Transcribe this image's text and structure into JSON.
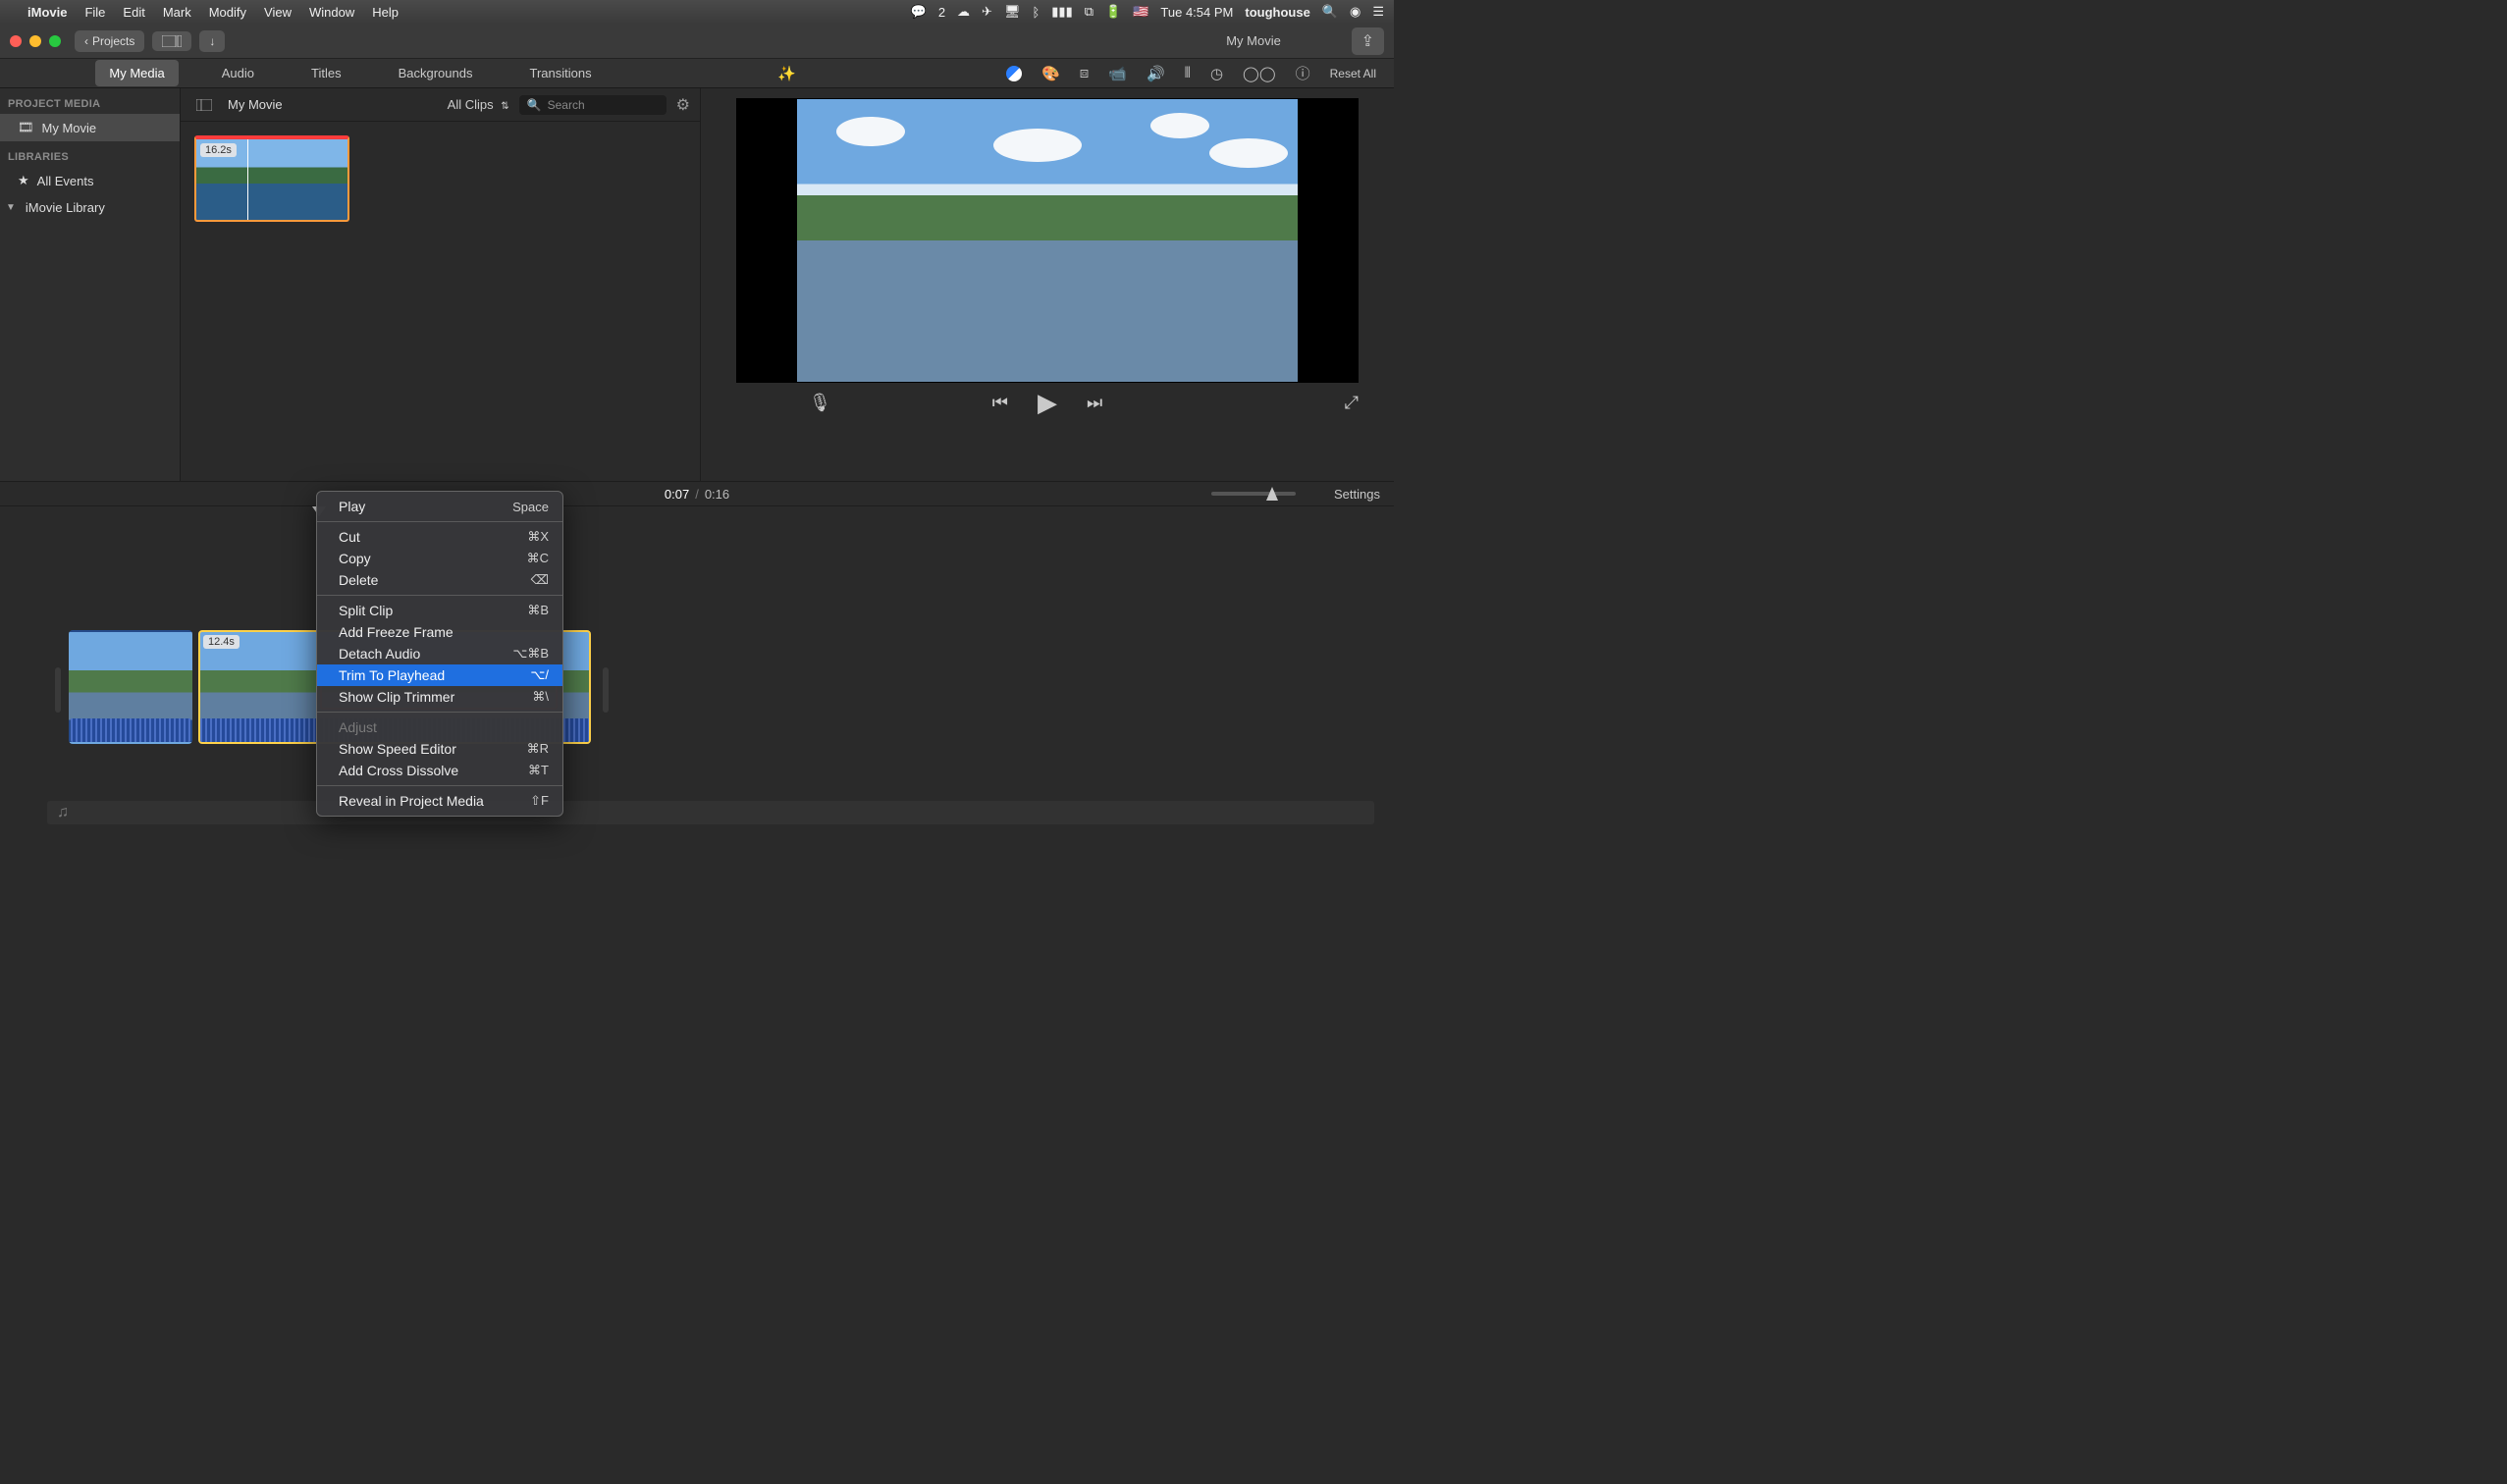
{
  "menubar": {
    "app": "iMovie",
    "items": [
      "File",
      "Edit",
      "Mark",
      "Modify",
      "View",
      "Window",
      "Help"
    ],
    "badge": "2",
    "time": "Tue 4:54 PM",
    "user": "toughouse"
  },
  "titlebar": {
    "back_label": "Projects",
    "title": "My Movie"
  },
  "tabs": {
    "items": [
      "My Media",
      "Audio",
      "Titles",
      "Backgrounds",
      "Transitions"
    ],
    "active": 0,
    "reset": "Reset All"
  },
  "sidebar": {
    "section1": "PROJECT MEDIA",
    "project": "My Movie",
    "section2": "LIBRARIES",
    "all_events": "All Events",
    "library": "iMovie Library"
  },
  "browser": {
    "crumb": "My Movie",
    "filter": "All Clips",
    "search_placeholder": "Search",
    "clip_duration": "16.2s"
  },
  "playback": {
    "current": "0:07",
    "total": "0:16",
    "settings": "Settings"
  },
  "timeline": {
    "clip2_duration": "12.4s"
  },
  "context_menu": {
    "play": "Play",
    "play_sc": "Space",
    "cut": "Cut",
    "cut_sc": "⌘X",
    "copy": "Copy",
    "copy_sc": "⌘C",
    "delete": "Delete",
    "delete_sc": "⌫",
    "split": "Split Clip",
    "split_sc": "⌘B",
    "freeze": "Add Freeze Frame",
    "detach": "Detach Audio",
    "detach_sc": "⌥⌘B",
    "trim": "Trim To Playhead",
    "trim_sc": "⌥/",
    "trimmer": "Show Clip Trimmer",
    "trimmer_sc": "⌘\\",
    "adjust": "Adjust",
    "speed": "Show Speed Editor",
    "speed_sc": "⌘R",
    "dissolve": "Add Cross Dissolve",
    "dissolve_sc": "⌘T",
    "reveal": "Reveal in Project Media",
    "reveal_sc": "⇧F"
  }
}
